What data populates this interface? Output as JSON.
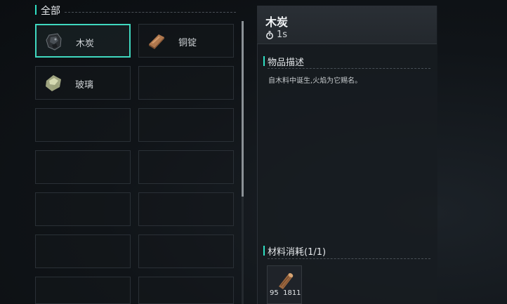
{
  "category": {
    "label": "全部"
  },
  "items": [
    {
      "name": "木炭",
      "icon": "charcoal-icon",
      "selected": true
    },
    {
      "name": "铜锭",
      "icon": "copper-ingot-icon",
      "selected": false
    },
    {
      "name": "玻璃",
      "icon": "glass-icon",
      "selected": false
    }
  ],
  "detail": {
    "title": "木炭",
    "time_icon": "timer-icon",
    "time": "1s",
    "description_title": "物品描述",
    "description": "自木料中诞生,火焰为它赐名。",
    "materials_title": "材料消耗(1/1)",
    "materials": [
      {
        "icon": "wood-log-icon",
        "have": "95",
        "need": "1811"
      }
    ]
  },
  "colors": {
    "accent": "#2fe0c4",
    "selected_border": "#3fd8bf"
  }
}
